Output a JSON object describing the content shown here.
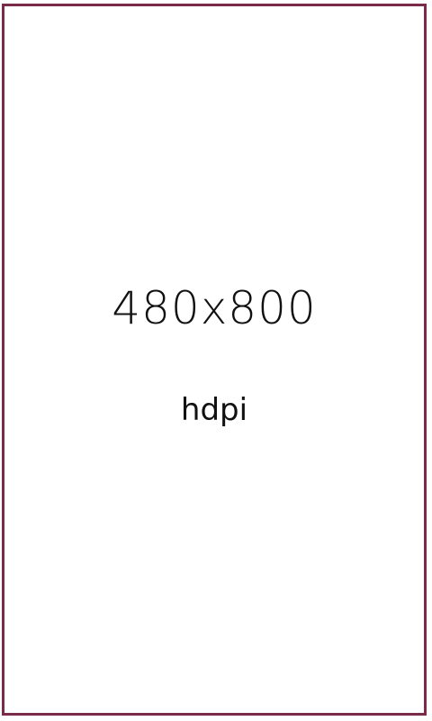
{
  "placeholder": {
    "resolution_text": "480x800",
    "density_text": "hdpi",
    "border_color": "#7a2b4a"
  }
}
